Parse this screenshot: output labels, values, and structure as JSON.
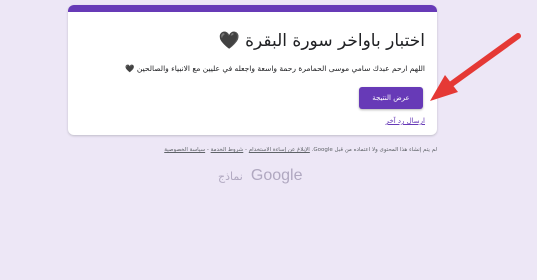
{
  "form": {
    "title": "اختبار باواخر سورة البقرة",
    "title_icon": "black-heart-icon",
    "title_heart": "🖤",
    "description": "اللهم ارحم عبدك سامي موسى الحمامرة رحمة واسعة واجعله في عليين مع الانبياء والصالحين",
    "description_heart": "🖤",
    "result_button_label": "عرض النتيجة",
    "resend_link_label": "ارسال رد آخر"
  },
  "footer": {
    "disclaimer": "لم يتم إنشاء هذا المحتوى ولا اعتماده من قبل Google.",
    "report_link": "الإبلاغ عن إساءة الاستخدام",
    "sep1": " - ",
    "terms_link": "شروط الخدمة",
    "sep2": " - ",
    "privacy_link": "سياسة الخصوصية"
  },
  "branding": {
    "google": "Google",
    "forms": "نماذج"
  },
  "colors": {
    "accent": "#673ab7",
    "background": "#ede7f6",
    "arrow": "#e53935"
  }
}
